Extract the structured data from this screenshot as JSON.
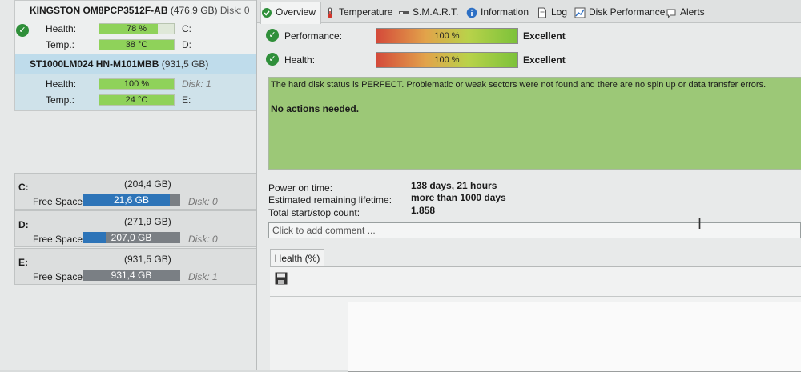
{
  "disks": [
    {
      "name": "KINGSTON OM8PCP3512F-AB",
      "size": "(476,9 GB)",
      "disk_no": "Disk: 0",
      "health_label": "Health:",
      "health_value": "78 %",
      "health_fraction": 0.78,
      "health_letter": "C:",
      "temp_label": "Temp.:",
      "temp_value": "38 °C",
      "temp_letter": "D:"
    },
    {
      "name": "ST1000LM024 HN-M101MBB",
      "size": "(931,5 GB)",
      "health_label": "Health:",
      "health_value": "100 %",
      "health_fraction": 1.0,
      "health_letter": "Disk: 1",
      "temp_label": "Temp.:",
      "temp_value": "24 °C",
      "temp_letter": "E:"
    }
  ],
  "partitions": [
    {
      "letter": "C:",
      "size": "(204,4 GB)",
      "free_label": "Free Space",
      "free": "21,6 GB",
      "used_fraction": 0.894,
      "disk": "Disk: 0"
    },
    {
      "letter": "D:",
      "size": "(271,9 GB)",
      "free_label": "Free Space",
      "free": "207,0 GB",
      "used_fraction": 0.239,
      "disk": "Disk: 0"
    },
    {
      "letter": "E:",
      "size": "(931,5 GB)",
      "free_label": "Free Space",
      "free": "931,4 GB",
      "used_fraction": 0.0,
      "disk": "Disk: 1"
    }
  ],
  "tabs": [
    "Overview",
    "Temperature",
    "S.M.A.R.T.",
    "Information",
    "Log",
    "Disk Performance",
    "Alerts"
  ],
  "metrics": [
    {
      "label": "Performance:",
      "value": "100 %",
      "rating": "Excellent"
    },
    {
      "label": "Health:",
      "value": "100 %",
      "rating": "Excellent"
    }
  ],
  "status": {
    "line1": "The hard disk status is PERFECT. Problematic or weak sectors were not found and there are no spin up or data transfer errors.",
    "line2": "No actions needed."
  },
  "info": {
    "power_on_label": "Power on time:",
    "power_on_value": "138 days, 21 hours",
    "lifetime_label": "Estimated remaining lifetime:",
    "lifetime_value": "more than 1000 days",
    "startstop_label": "Total start/stop count:",
    "startstop_value": "1.858"
  },
  "comment_placeholder": "Click to add comment ...",
  "health_tab": "Health (%)",
  "colors": {
    "ok_green": "#2f8f3a",
    "bar_green": "#8fd25a",
    "free_blue": "#2d74b8",
    "status_bg": "#9cc877",
    "selected_disk": "#cfe2ea"
  },
  "icons": [
    "check-circle-icon",
    "overview-icon",
    "thermometer-icon",
    "smart-icon",
    "info-icon",
    "log-icon",
    "performance-icon",
    "alerts-icon",
    "save-icon",
    "text-cursor-icon"
  ]
}
